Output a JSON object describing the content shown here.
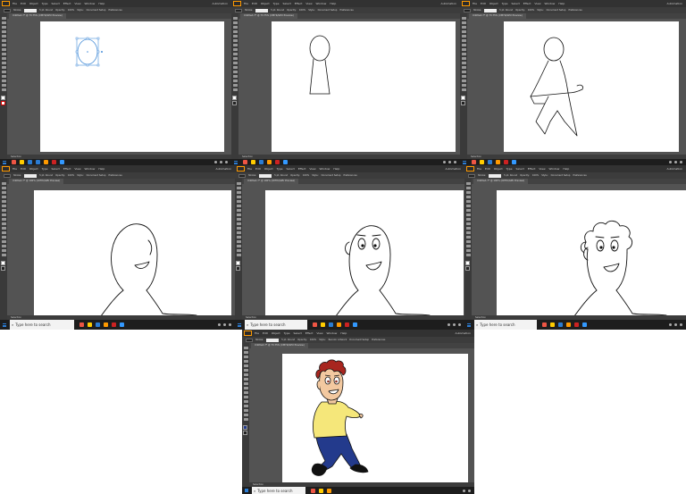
{
  "app": {
    "menu": [
      "File",
      "Edit",
      "Object",
      "Type",
      "Select",
      "Effect",
      "View",
      "Window",
      "Help"
    ],
    "workspace": "Automation",
    "control_bar": [
      "Stroke:",
      "Uniform",
      "5 pt. Round",
      "Opacity:",
      "100%",
      "Style:",
      "Recolor Artwork",
      "Document Setup",
      "Preferences"
    ],
    "status_zoom": "Selection"
  },
  "panels": [
    {
      "tab": "Untitled-7* @ 73.75% (CMYK/GPU Preview)",
      "step": "head-oval"
    },
    {
      "tab": "Untitled-7* @ 73.75% (CMYK/GPU Preview)",
      "step": "head-body"
    },
    {
      "tab": "Untitled-7* @ 73.75% (CMYK/GPU Preview)",
      "step": "body-legs"
    },
    {
      "tab": "Untitled-7* @ 100% (CMYK/GPU Preview)",
      "step": "face-smile"
    },
    {
      "tab": "Untitled-7* @ 100% (CMYK/GPU Preview)",
      "step": "face-eyes"
    },
    {
      "tab": "Untitled-7* @ 100% (CMYK/GPU Preview)",
      "step": "hair"
    },
    {
      "tab": "Untitled-7* @ 73.75% (CMYK/GPU Preview)",
      "step": "colored"
    }
  ],
  "taskbar": {
    "search_placeholder": "Type here to search"
  },
  "colors": {
    "shirt": "#f5e77a",
    "pants": "#233a8c",
    "hair": "#a8261f",
    "skin": "#f3c9a0",
    "shoes": "#111111",
    "ui_dark": "#535353",
    "accent_orange": "#ff9a00"
  }
}
